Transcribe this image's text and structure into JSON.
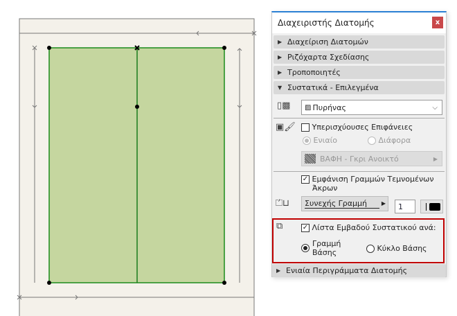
{
  "panel": {
    "title": "Διαχειριστής Διατομής",
    "close_label": "x",
    "sections": [
      {
        "label": "Διαχείριση Διατομών",
        "expanded": false
      },
      {
        "label": "Ριζόχαρτα Σχεδίασης",
        "expanded": false
      },
      {
        "label": "Τροποποιητές",
        "expanded": false
      },
      {
        "label": "Συστατικά - Επιλεγμένα",
        "expanded": true
      }
    ],
    "component_select": {
      "value": "Πυρήνας"
    },
    "override_surfaces": {
      "label": "Υπερισχύουσες Επιφάνειες",
      "checked": false
    },
    "surface_radio": {
      "uniform": "Ενιαίο",
      "different": "Διάφορα",
      "selected": "uniform"
    },
    "surface_fill": {
      "label": "ΒΑΦΗ - Γκρι Ανοικτό"
    },
    "show_end_lines": {
      "label_line1": "Εμφάνιση Γραμμών Τεμνομένων",
      "label_line2": "Άκρων",
      "checked": true
    },
    "line_type": {
      "label": "Συνεχής Γραμμή"
    },
    "pen_number": "1",
    "area_list": {
      "label": "Λίστα Εμβαδού Συστατικού ανά:",
      "checked": true,
      "option_reference_line_1": "Γραμμή",
      "option_reference_line_2": "Βάσης",
      "option_base_circle": "Κύκλο Βάσης",
      "selected": "reference_line"
    },
    "bottom_section": {
      "label": "Ενιαία Περιγράμματα Διατομής",
      "expanded": false
    }
  },
  "colors": {
    "fill": "#c5d69f",
    "edge": "#1a8a1a",
    "highlight": "#c00000",
    "bg": "#f4f1ea"
  }
}
